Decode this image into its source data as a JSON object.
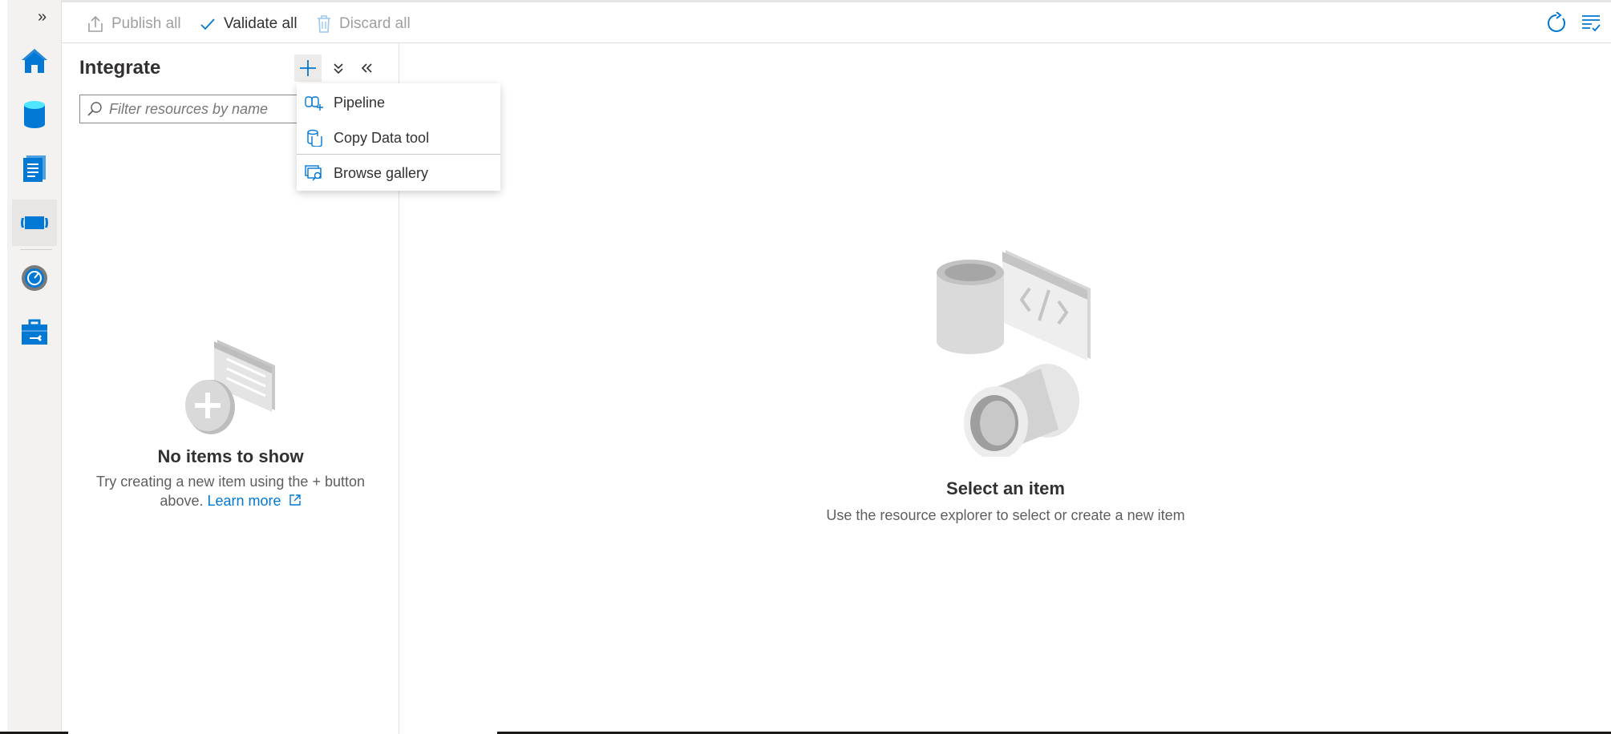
{
  "toolbar": {
    "publish_label": "Publish all",
    "validate_label": "Validate all",
    "discard_label": "Discard all"
  },
  "nav": {
    "expand_glyph": "»",
    "items": [
      {
        "icon": "home-icon"
      },
      {
        "icon": "data-icon"
      },
      {
        "icon": "develop-icon"
      },
      {
        "icon": "integrate-icon",
        "active": true
      },
      {
        "icon": "monitor-icon"
      },
      {
        "icon": "manage-icon"
      }
    ]
  },
  "explorer": {
    "title": "Integrate",
    "filter_placeholder": "Filter resources by name",
    "empty_title": "No items to show",
    "empty_desc_1": "Try creating a new item using the + button",
    "empty_desc_2": "above.",
    "learn_more": "Learn more"
  },
  "dropdown": {
    "items": [
      {
        "label": "Pipeline",
        "icon": "pipeline-icon"
      },
      {
        "label": "Copy Data tool",
        "icon": "copy-data-icon"
      },
      {
        "label": "Browse gallery",
        "icon": "gallery-icon"
      }
    ]
  },
  "main": {
    "title": "Select an item",
    "desc": "Use the resource explorer to select or create a new item"
  },
  "colors": {
    "accent": "#0078d4",
    "nav_bg": "#f3f2f1"
  }
}
